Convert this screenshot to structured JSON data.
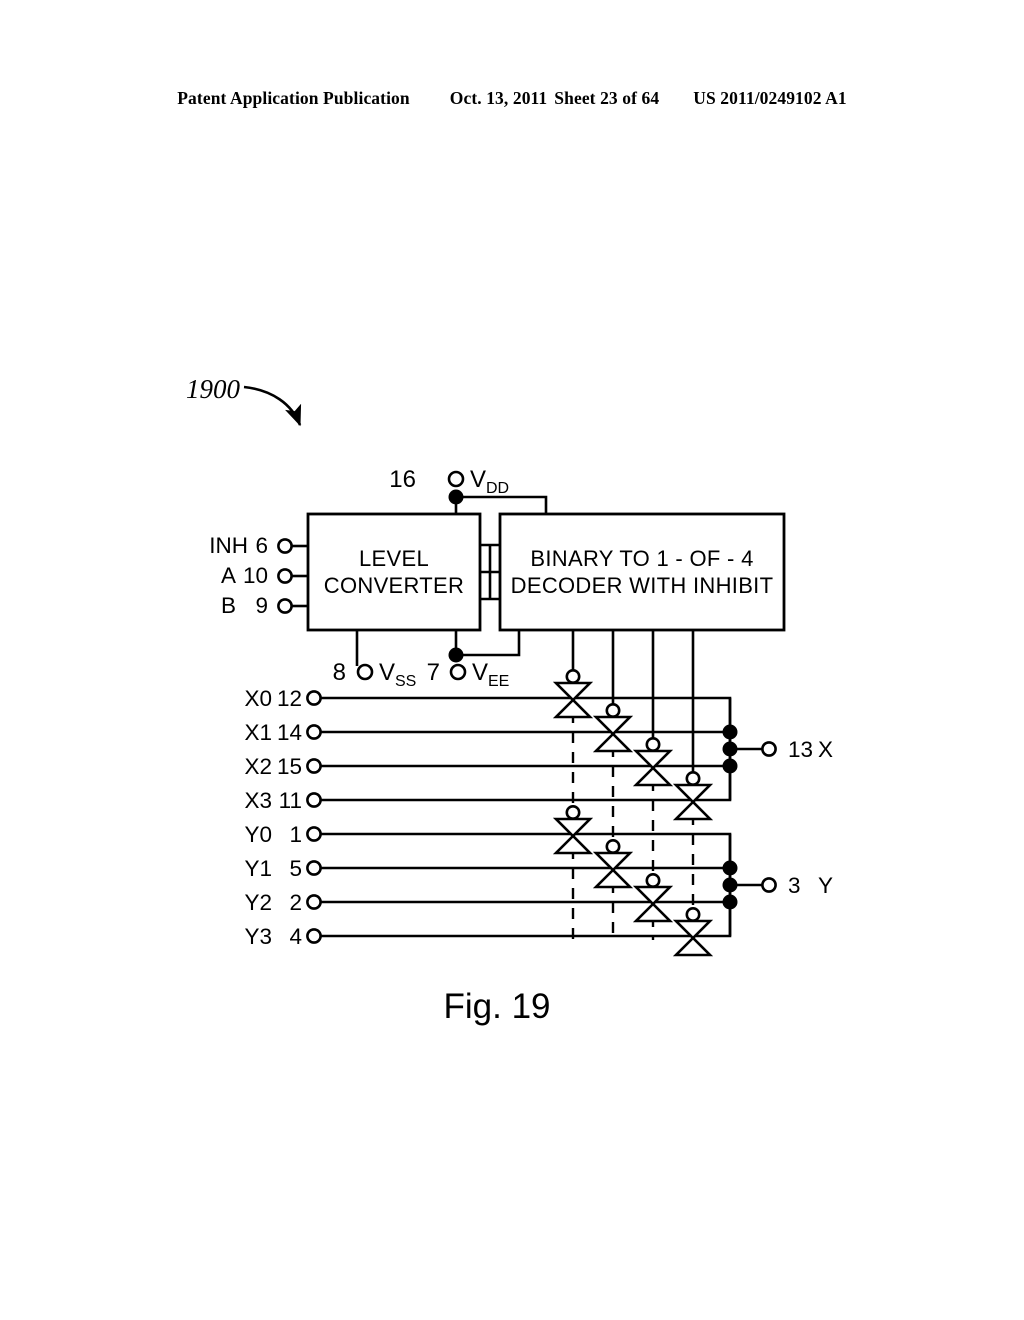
{
  "header": {
    "publication": "Patent Application Publication",
    "date": "Oct. 13, 2011",
    "sheet": "Sheet 23 of 64",
    "patent_number": "US 2011/0249102 A1"
  },
  "figure": {
    "reference_numeral": "1900",
    "caption": "Fig. 19",
    "blocks": [
      {
        "id": "level-converter",
        "line1": "LEVEL",
        "line2": "CONVERTER"
      },
      {
        "id": "decoder",
        "line1": "BINARY TO 1 - OF - 4",
        "line2": "DECODER WITH INHIBIT"
      }
    ],
    "control_inputs": [
      {
        "label": "INH",
        "pin": "6"
      },
      {
        "label": "A",
        "pin": "10"
      },
      {
        "label": "B",
        "pin": "9"
      }
    ],
    "power_rails": [
      {
        "pin": "16",
        "name": "V",
        "sub": "DD"
      },
      {
        "pin": "8",
        "name": "V",
        "sub": "SS"
      },
      {
        "pin": "7",
        "name": "V",
        "sub": "EE"
      }
    ],
    "switch_inputs": [
      {
        "label": "X0",
        "pin": "12"
      },
      {
        "label": "X1",
        "pin": "14"
      },
      {
        "label": "X2",
        "pin": "15"
      },
      {
        "label": "X3",
        "pin": "11"
      },
      {
        "label": "Y0",
        "pin": "1"
      },
      {
        "label": "Y1",
        "pin": "5"
      },
      {
        "label": "Y2",
        "pin": "2"
      },
      {
        "label": "Y3",
        "pin": "4"
      }
    ],
    "outputs": [
      {
        "pin": "13",
        "label": "X"
      },
      {
        "pin": "3",
        "label": "Y"
      }
    ],
    "colors": {
      "ink": "#000000",
      "paper": "#ffffff"
    }
  }
}
